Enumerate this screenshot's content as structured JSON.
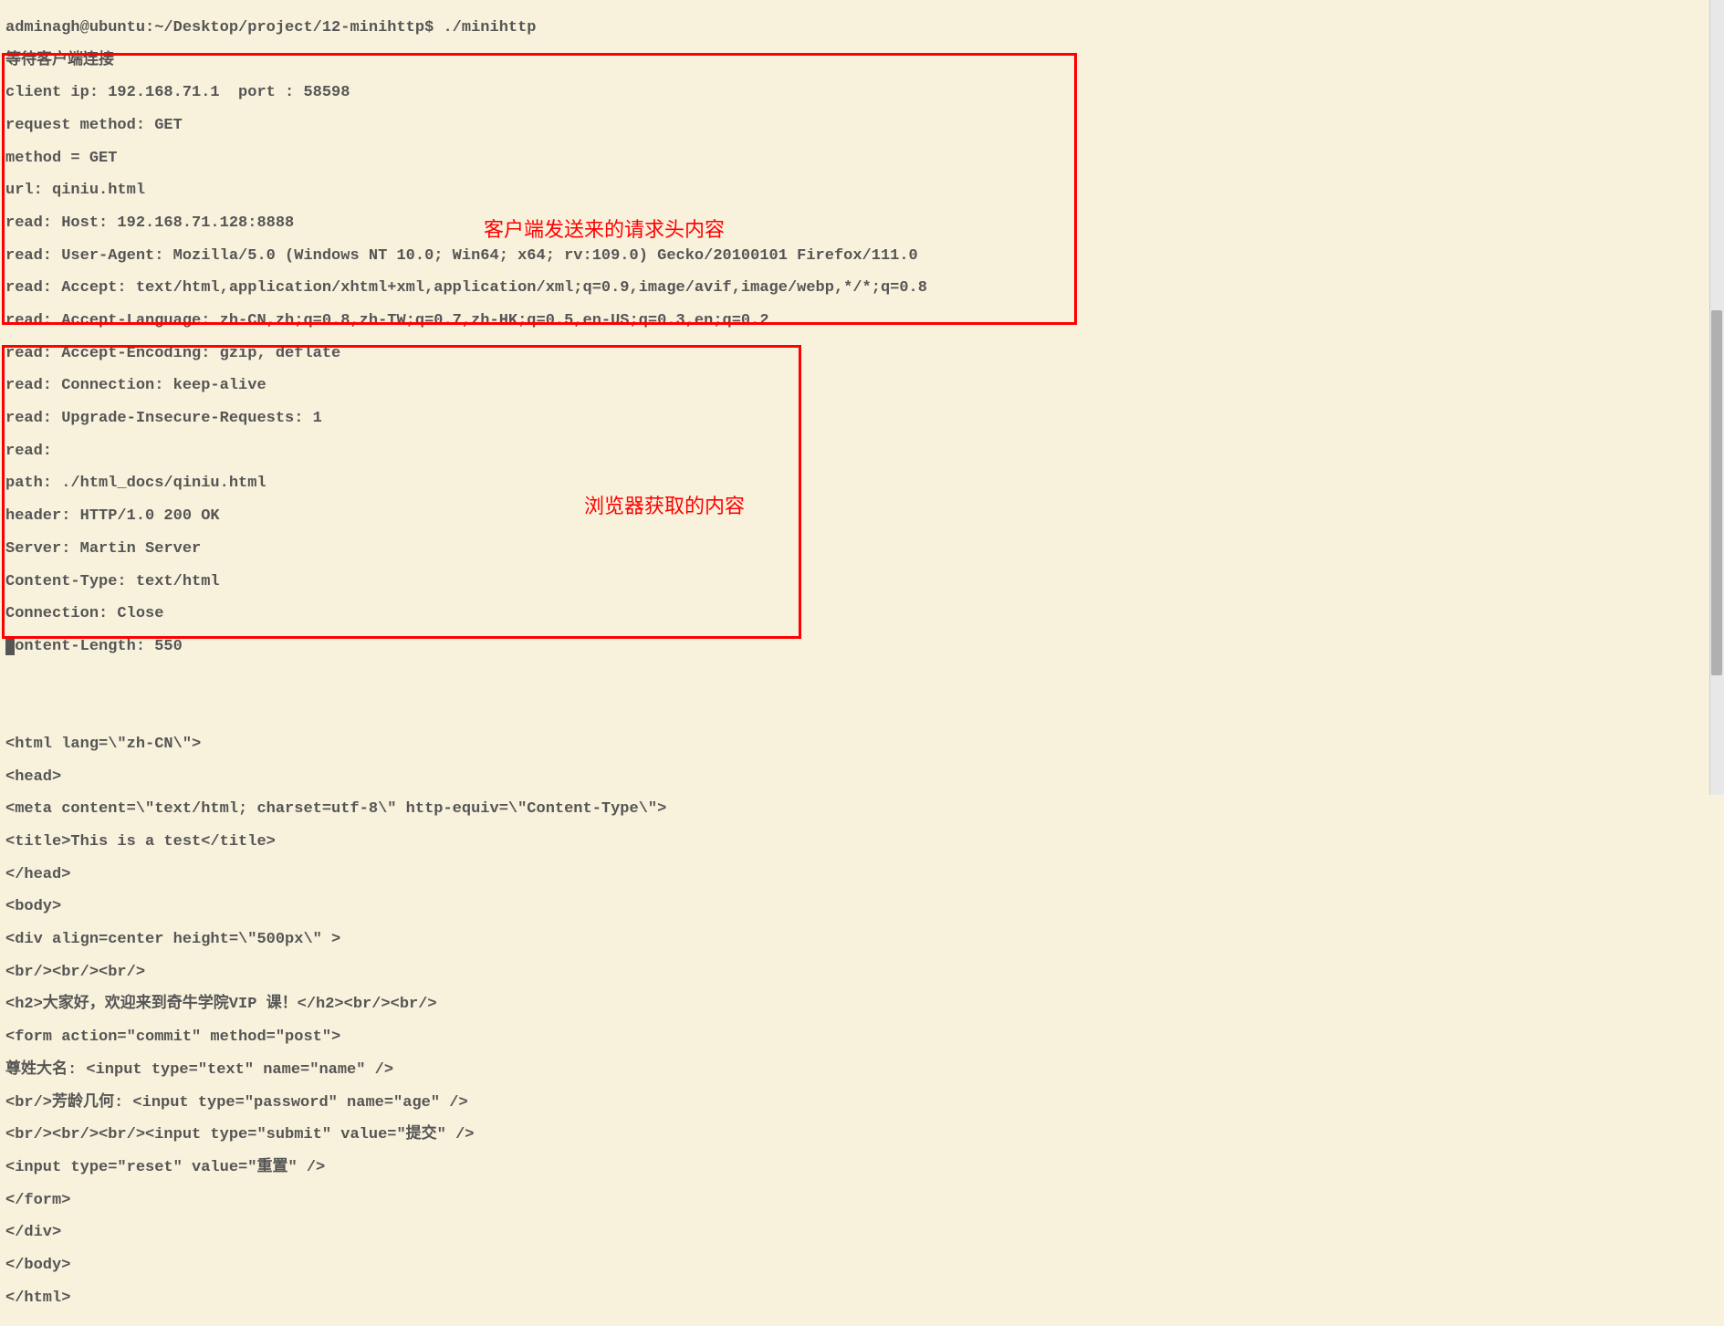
{
  "terminal": {
    "line0": "adminagh@ubuntu:~/Desktop/project/12-minihttp$ ./minihttp",
    "line1": "等待客户端连接",
    "line2": "client ip: 192.168.71.1  port : 58598",
    "line3": "request method: GET",
    "line4": "method = GET",
    "line5": "url: qiniu.html",
    "line6": "read: Host: 192.168.71.128:8888",
    "line7": "read: User-Agent: Mozilla/5.0 (Windows NT 10.0; Win64; x64; rv:109.0) Gecko/20100101 Firefox/111.0",
    "line8": "read: Accept: text/html,application/xhtml+xml,application/xml;q=0.9,image/avif,image/webp,*/*;q=0.8",
    "line9": "read: Accept-Language: zh-CN,zh;q=0.8,zh-TW;q=0.7,zh-HK;q=0.5,en-US;q=0.3,en;q=0.2",
    "line10": "read: Accept-Encoding: gzip, deflate",
    "line11": "read: Connection: keep-alive",
    "line12": "read: Upgrade-Insecure-Requests: 1",
    "line13": "read:",
    "line14": "path: ./html_docs/qiniu.html",
    "line15": "header: HTTP/1.0 200 OK",
    "line16": "Server: Martin Server",
    "line17": "Content-Type: text/html",
    "line18": "Connection: Close",
    "line19": "Content-Length: 550",
    "blank1": " ",
    "blank2": " ",
    "html0": "<html lang=\\\"zh-CN\\\">",
    "html1": "<head>",
    "html2": "<meta content=\\\"text/html; charset=utf-8\\\" http-equiv=\\\"Content-Type\\\">",
    "html3": "<title>This is a test</title>",
    "html4": "</head>",
    "html5": "<body>",
    "html6": "<div align=center height=\\\"500px\\\" >",
    "html7": "<br/><br/><br/>",
    "html8": "<h2>大家好，欢迎来到奇牛学院VIP 课！</h2><br/><br/>",
    "html9": "<form action=\"commit\" method=\"post\">",
    "html10": "尊姓大名: <input type=\"text\" name=\"name\" />",
    "html11": "<br/>芳龄几何: <input type=\"password\" name=\"age\" />",
    "html12": "<br/><br/><br/><input type=\"submit\" value=\"提交\" />",
    "html13": "<input type=\"reset\" value=\"重置\" />",
    "html14": "</form>",
    "html15": "</div>",
    "html16": "</body>",
    "html17": "</html>"
  },
  "annotations": {
    "box1_label": "客户端发送来的请求头内容",
    "box2_label": "浏览器获取的内容"
  }
}
